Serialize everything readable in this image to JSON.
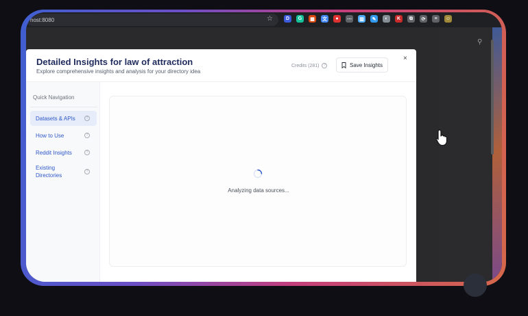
{
  "browser": {
    "url": "host:8080",
    "extensions": [
      {
        "name": "d-extension-icon",
        "color": "#3b5bdb",
        "glyph": "D"
      },
      {
        "name": "grammarly-icon",
        "color": "#15c39a",
        "glyph": "G"
      },
      {
        "name": "colorpick-icon",
        "color": "#d9480f",
        "glyph": "▦"
      },
      {
        "name": "translate-icon",
        "color": "#4285f4",
        "glyph": "文"
      },
      {
        "name": "pokeball-icon",
        "color": "#e03131",
        "glyph": "●"
      },
      {
        "name": "dots-icon",
        "color": "#5f6368",
        "glyph": "⋯"
      },
      {
        "name": "grid-icon",
        "color": "#4dabf7",
        "glyph": "▥"
      },
      {
        "name": "pen-icon",
        "color": "#339af0",
        "glyph": "✎"
      },
      {
        "name": "circle-icon",
        "color": "#868e96",
        "glyph": "◐"
      },
      {
        "name": "k-extension-icon",
        "color": "#c92a2a",
        "glyph": "K"
      },
      {
        "name": "puzzle-icon",
        "color": "#5f6368",
        "glyph": "⧉"
      },
      {
        "name": "sync-icon",
        "color": "#5f6368",
        "glyph": "⟳"
      },
      {
        "name": "queue-icon",
        "color": "#5f6368",
        "glyph": "≡"
      },
      {
        "name": "profile-avatar-icon",
        "color": "#a08a3a",
        "glyph": "☺"
      }
    ]
  },
  "modal": {
    "title": "Detailed Insights for law of attraction",
    "subtitle": "Explore comprehensive insights and analysis for your directory idea",
    "credits": "Credits (281)",
    "save_label": "Save Insights",
    "close_label": "×"
  },
  "sidebar": {
    "title": "Quick Navigation",
    "items": [
      {
        "label": "Datasets & APIs",
        "active": true
      },
      {
        "label": "How to Use",
        "active": false
      },
      {
        "label": "Reddit Insights",
        "active": false
      },
      {
        "label": "Existing Directories",
        "active": false
      }
    ]
  },
  "content": {
    "loading_text": "Analyzing data sources..."
  },
  "colors": {
    "accent": "#2d56c8",
    "title": "#1e2a5c",
    "active_bg": "#e6ecfa"
  }
}
